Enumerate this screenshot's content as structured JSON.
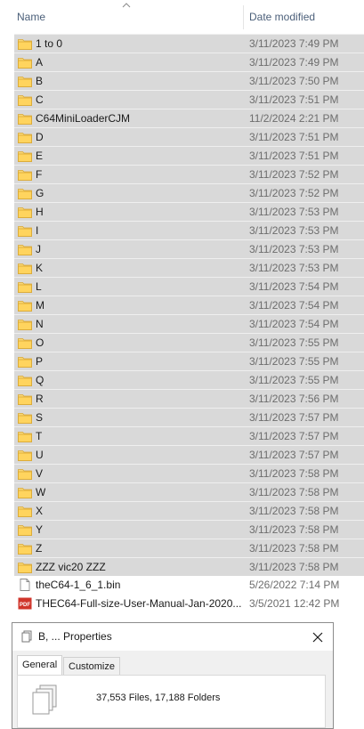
{
  "header": {
    "name_label": "Name",
    "date_label": "Date modified"
  },
  "rows": [
    {
      "name": "1 to 0",
      "date": "3/11/2023 7:49 PM",
      "type": "folder",
      "selected": true
    },
    {
      "name": "A",
      "date": "3/11/2023 7:49 PM",
      "type": "folder",
      "selected": true
    },
    {
      "name": "B",
      "date": "3/11/2023 7:50 PM",
      "type": "folder",
      "selected": true
    },
    {
      "name": "C",
      "date": "3/11/2023 7:51 PM",
      "type": "folder",
      "selected": true
    },
    {
      "name": "C64MiniLoaderCJM",
      "date": "11/2/2024 2:21 PM",
      "type": "folder",
      "selected": true
    },
    {
      "name": "D",
      "date": "3/11/2023 7:51 PM",
      "type": "folder",
      "selected": true
    },
    {
      "name": "E",
      "date": "3/11/2023 7:51 PM",
      "type": "folder",
      "selected": true
    },
    {
      "name": "F",
      "date": "3/11/2023 7:52 PM",
      "type": "folder",
      "selected": true
    },
    {
      "name": "G",
      "date": "3/11/2023 7:52 PM",
      "type": "folder",
      "selected": true
    },
    {
      "name": "H",
      "date": "3/11/2023 7:53 PM",
      "type": "folder",
      "selected": true
    },
    {
      "name": "I",
      "date": "3/11/2023 7:53 PM",
      "type": "folder",
      "selected": true
    },
    {
      "name": "J",
      "date": "3/11/2023 7:53 PM",
      "type": "folder",
      "selected": true
    },
    {
      "name": "K",
      "date": "3/11/2023 7:53 PM",
      "type": "folder",
      "selected": true
    },
    {
      "name": "L",
      "date": "3/11/2023 7:54 PM",
      "type": "folder",
      "selected": true
    },
    {
      "name": "M",
      "date": "3/11/2023 7:54 PM",
      "type": "folder",
      "selected": true
    },
    {
      "name": "N",
      "date": "3/11/2023 7:54 PM",
      "type": "folder",
      "selected": true
    },
    {
      "name": "O",
      "date": "3/11/2023 7:55 PM",
      "type": "folder",
      "selected": true
    },
    {
      "name": "P",
      "date": "3/11/2023 7:55 PM",
      "type": "folder",
      "selected": true
    },
    {
      "name": "Q",
      "date": "3/11/2023 7:55 PM",
      "type": "folder",
      "selected": true
    },
    {
      "name": "R",
      "date": "3/11/2023 7:56 PM",
      "type": "folder",
      "selected": true
    },
    {
      "name": "S",
      "date": "3/11/2023 7:57 PM",
      "type": "folder",
      "selected": true
    },
    {
      "name": "T",
      "date": "3/11/2023 7:57 PM",
      "type": "folder",
      "selected": true
    },
    {
      "name": "U",
      "date": "3/11/2023 7:57 PM",
      "type": "folder",
      "selected": true
    },
    {
      "name": "V",
      "date": "3/11/2023 7:58 PM",
      "type": "folder",
      "selected": true
    },
    {
      "name": "W",
      "date": "3/11/2023 7:58 PM",
      "type": "folder",
      "selected": true
    },
    {
      "name": "X",
      "date": "3/11/2023 7:58 PM",
      "type": "folder",
      "selected": true
    },
    {
      "name": "Y",
      "date": "3/11/2023 7:58 PM",
      "type": "folder",
      "selected": true
    },
    {
      "name": "Z",
      "date": "3/11/2023 7:58 PM",
      "type": "folder",
      "selected": true
    },
    {
      "name": "ZZZ vic20 ZZZ",
      "date": "3/11/2023 7:58 PM",
      "type": "folder",
      "selected": true
    },
    {
      "name": "theC64-1_6_1.bin",
      "date": "5/26/2022 7:14 PM",
      "type": "file",
      "selected": false
    },
    {
      "name": "THEC64-Full-size-User-Manual-Jan-2020...",
      "date": "3/5/2021 12:42 PM",
      "type": "pdf",
      "selected": false
    }
  ],
  "dialog": {
    "title": "B, ... Properties",
    "close_icon": "close-icon",
    "tabs": [
      "General",
      "Customize"
    ],
    "active_tab": "General",
    "counts_text": "37,553 Files, 17,188 Folders"
  },
  "colors": {
    "selection": "#d9d9d9",
    "folder": "#f8d775",
    "pdf_red": "#d0352b",
    "header_text": "#4c607a"
  }
}
